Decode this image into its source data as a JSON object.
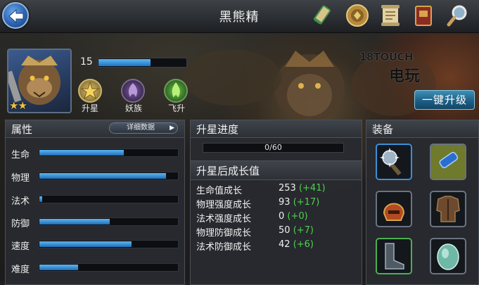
{
  "header": {
    "title": "黑熊精",
    "icons": [
      "map-scroll-icon",
      "medal-coin-icon",
      "quest-scroll-icon",
      "spellbook-icon",
      "magnifier-icon"
    ]
  },
  "hero": {
    "level": "15",
    "level_progress": 0.6,
    "star_count": 2,
    "stars": "★★"
  },
  "actions": {
    "star_up": "升星",
    "race": "妖族",
    "ascend": "飞升",
    "one_click_upgrade": "一键升级"
  },
  "watermark": {
    "line1": "18TOUCH",
    "line2": "电玩"
  },
  "attributes": {
    "title": "属性",
    "detail_button": "详细数据",
    "items": [
      {
        "label": "生命",
        "fill": 0.61
      },
      {
        "label": "物理",
        "fill": 0.92
      },
      {
        "label": "法术",
        "fill": 0.02
      },
      {
        "label": "防御",
        "fill": 0.51
      },
      {
        "label": "速度",
        "fill": 0.67
      },
      {
        "label": "难度",
        "fill": 0.28
      }
    ]
  },
  "star_progress": {
    "title": "升星进度",
    "text": "0/60",
    "fraction": 0
  },
  "growth": {
    "title": "升星后成长值",
    "rows": [
      {
        "label": "生命值成长",
        "value": "253",
        "bonus": "(+41)"
      },
      {
        "label": "物理强度成长",
        "value": "93",
        "bonus": "(+17)"
      },
      {
        "label": "法术强度成长",
        "value": "0",
        "bonus": "(+0)"
      },
      {
        "label": "物理防御成长",
        "value": "50",
        "bonus": "(+7)"
      },
      {
        "label": "法术防御成长",
        "value": "42",
        "bonus": "(+6)"
      }
    ]
  },
  "equipment": {
    "title": "装备",
    "slots": [
      {
        "name": "spiked-mace-icon",
        "rarity": "blue"
      },
      {
        "name": "blue-gauntlet-icon",
        "rarity": "gray"
      },
      {
        "name": "war-helmet-icon",
        "rarity": "gray"
      },
      {
        "name": "leather-armor-icon",
        "rarity": "gray"
      },
      {
        "name": "iron-boots-icon",
        "rarity": "green"
      },
      {
        "name": "jade-gem-icon",
        "rarity": "gray"
      }
    ]
  },
  "colors": {
    "accent_blue": "#1f74c4",
    "bonus_green": "#4fd04f",
    "star_gold": "#f0c23a"
  }
}
